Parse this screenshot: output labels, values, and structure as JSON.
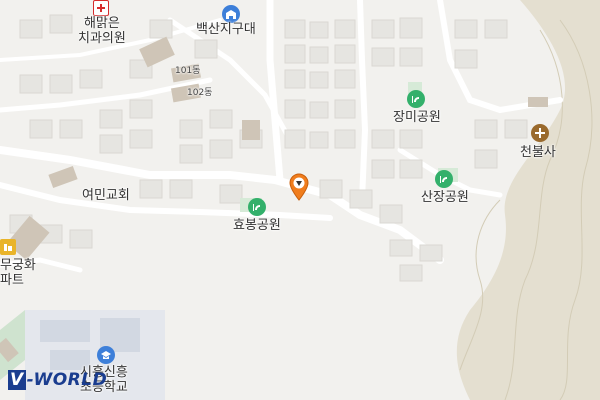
{
  "map": {
    "labels": [
      {
        "id": "dental",
        "text": "해맑은\n치과의원"
      },
      {
        "id": "district",
        "text": "백산지구대"
      },
      {
        "id": "bldg101",
        "text": "101동"
      },
      {
        "id": "bldg102",
        "text": "102동"
      },
      {
        "id": "rose_park",
        "text": "장미공원"
      },
      {
        "id": "cheonbul",
        "text": "천불사"
      },
      {
        "id": "yeomin",
        "text": "여민교회"
      },
      {
        "id": "hyobong",
        "text": "효봉공원"
      },
      {
        "id": "sanjang",
        "text": "산장공원"
      },
      {
        "id": "apt_partial",
        "text": "무궁화\n파트"
      },
      {
        "id": "school",
        "text": "시흥신흥\n초등학교"
      }
    ],
    "icons": {
      "hospital": "hospital-icon",
      "police": "police-icon",
      "park": "park-icon",
      "temple": "temple-icon",
      "apartment": "apartment-icon",
      "school": "school-icon",
      "marker": "location-marker-icon"
    },
    "colors": {
      "background": "#f2f1ee",
      "road": "#ffffff",
      "block": "#e6e5e1",
      "hill": "#dcd7c8",
      "park_green": "#33b06b",
      "marker_orange": "#f07d1d",
      "brand": "#1a3d8f"
    }
  },
  "logo": {
    "letter": "V",
    "rest": "-WORLD"
  }
}
